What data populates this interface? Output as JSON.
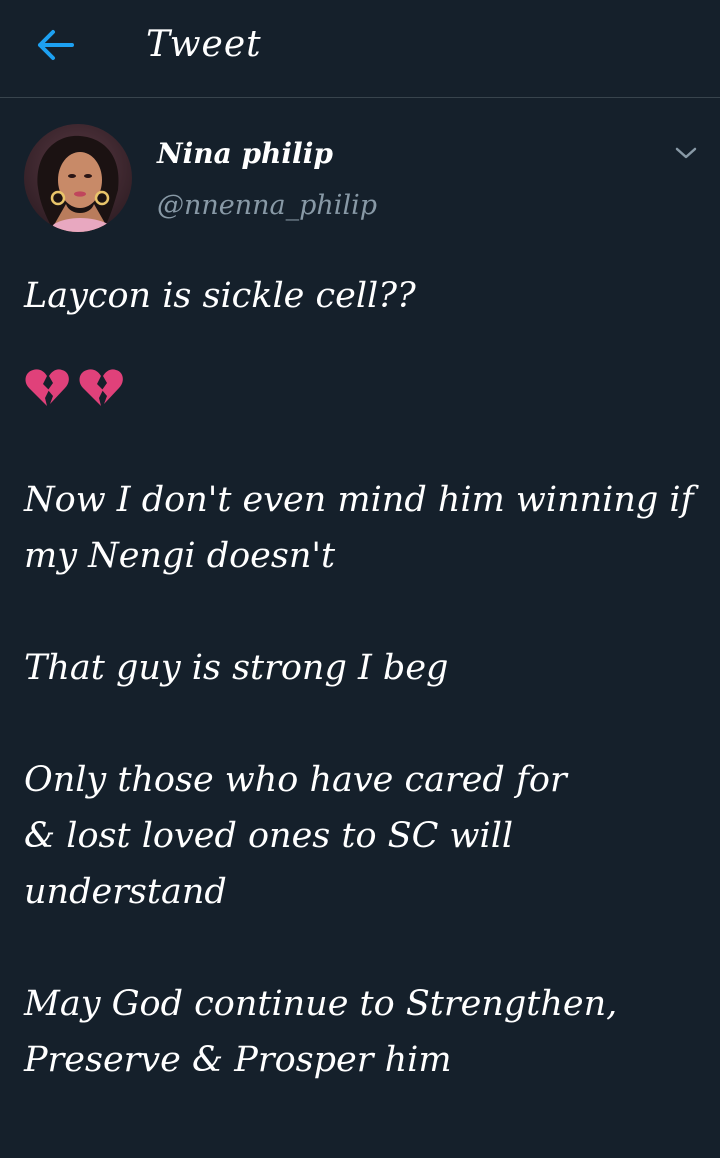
{
  "header": {
    "title": "Tweet",
    "back_icon": "arrow-left-icon",
    "accent_color": "#1da1f2"
  },
  "tweet": {
    "author": {
      "display_name": "Nina philip",
      "handle": "@nnenna_philip",
      "avatar_icon": "user-avatar"
    },
    "menu_icon": "chevron-down-icon",
    "paragraphs": [
      "Laycon is sickle cell??",
      "Now I don't even mind him winning if\nmy Nengi doesn't",
      "That guy is strong I beg",
      "Only those who have cared for\n& lost loved ones to SC will\nunderstand",
      "May God continue to Strengthen,\nPreserve & Prosper him"
    ],
    "emojis": [
      "broken-heart-icon",
      "broken-heart-icon"
    ],
    "emoji_color": "#e0417a"
  },
  "theme": {
    "background": "#15202b",
    "divider": "#38444d",
    "secondary_text": "#8899a6"
  }
}
